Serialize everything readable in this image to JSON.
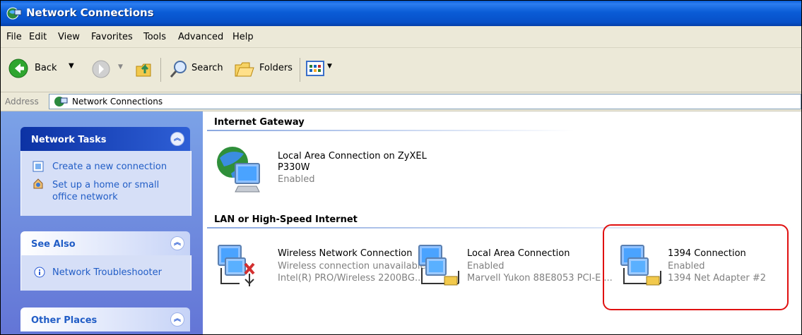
{
  "window": {
    "title": "Network Connections"
  },
  "menu": [
    "File",
    "Edit",
    "View",
    "Favorites",
    "Tools",
    "Advanced",
    "Help"
  ],
  "toolbar": {
    "back_label": "Back",
    "search_label": "Search",
    "folders_label": "Folders"
  },
  "address": {
    "label": "Address",
    "value": "Network Connections"
  },
  "sidebar": {
    "network_tasks": {
      "title": "Network Tasks",
      "items": [
        "Create a new connection",
        "Set up a home or small office network"
      ]
    },
    "see_also": {
      "title": "See Also",
      "items": [
        "Network Troubleshooter"
      ]
    },
    "other_places": {
      "title": "Other Places"
    }
  },
  "groups": [
    {
      "title": "Internet Gateway",
      "connections": [
        {
          "name": "Local Area Connection on ZyXEL P330W",
          "status": "Enabled",
          "device": ""
        }
      ]
    },
    {
      "title": "LAN or High-Speed Internet",
      "connections": [
        {
          "name": "Wireless Network Connection",
          "status": "Wireless connection unavailable",
          "device": "Intel(R) PRO/Wireless 2200BG..."
        },
        {
          "name": "Local Area Connection",
          "status": "Enabled",
          "device": "Marvell Yukon 88E8053 PCI-E ..."
        },
        {
          "name": "1394 Connection",
          "status": "Enabled",
          "device": "1394 Net Adapter #2"
        }
      ]
    }
  ],
  "colors": {
    "title_bar": "#0a5cd6",
    "chrome": "#ece9d8",
    "task_pane": "#7ba2e7",
    "link": "#215dc6",
    "highlight": "#e01010"
  }
}
